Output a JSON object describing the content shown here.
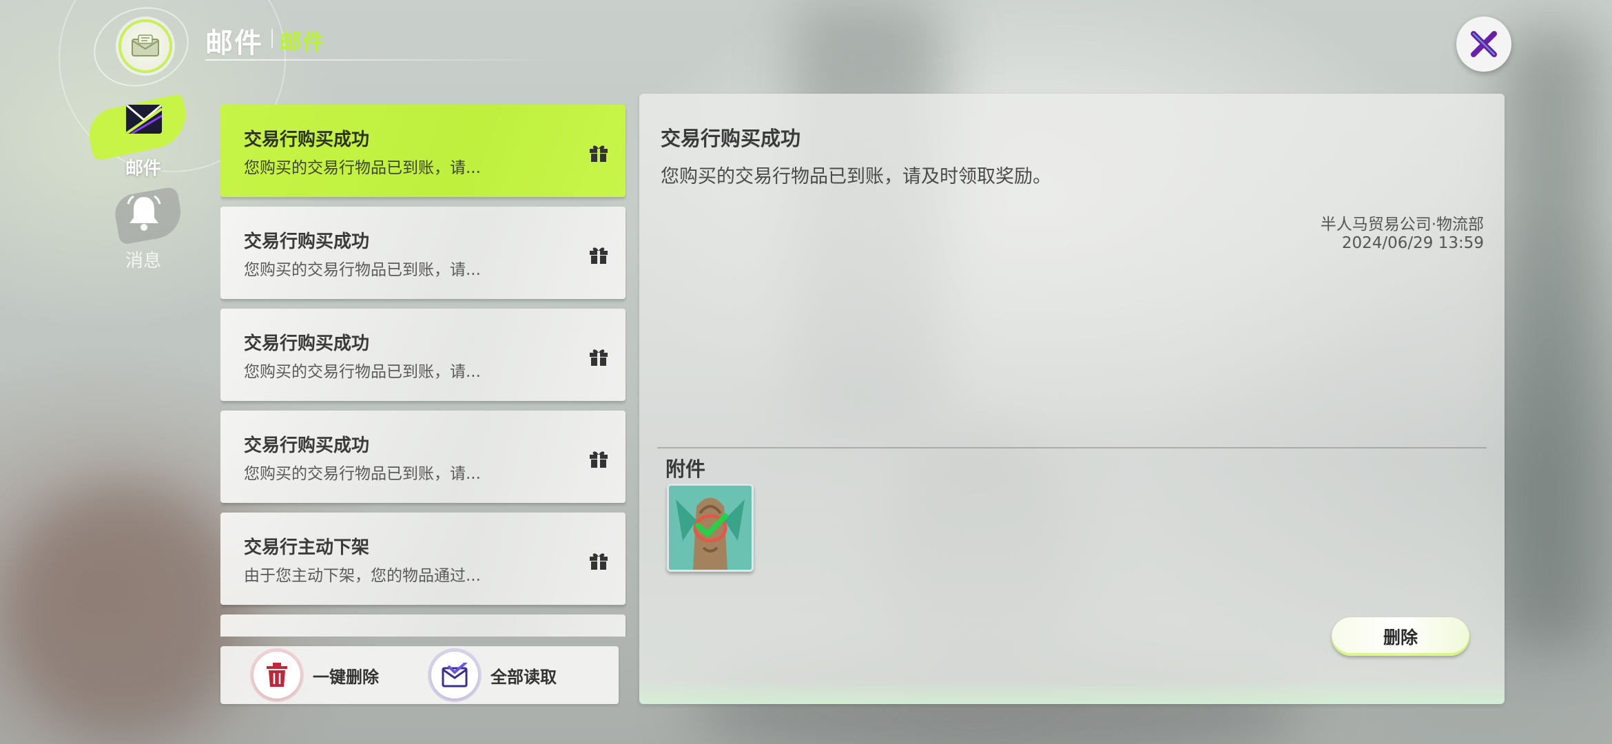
{
  "header": {
    "title": "邮件",
    "subtitle": "邮件",
    "icon": "mail-icon"
  },
  "nav": {
    "items": [
      {
        "label": "邮件",
        "icon": "mail-icon",
        "active": true
      },
      {
        "label": "消息",
        "icon": "bell-icon",
        "active": false
      }
    ]
  },
  "mail_list": {
    "items": [
      {
        "title": "交易行购买成功",
        "preview": "您购买的交易行物品已到账，请...",
        "icon": "gift-icon",
        "selected": true
      },
      {
        "title": "交易行购买成功",
        "preview": "您购买的交易行物品已到账，请...",
        "icon": "gift-icon",
        "selected": false
      },
      {
        "title": "交易行购买成功",
        "preview": "您购买的交易行物品已到账，请...",
        "icon": "gift-icon",
        "selected": false
      },
      {
        "title": "交易行购买成功",
        "preview": "您购买的交易行物品已到账，请...",
        "icon": "gift-icon",
        "selected": false
      },
      {
        "title": "交易行主动下架",
        "preview": "由于您主动下架，您的物品通过...",
        "icon": "gift-icon",
        "selected": false
      }
    ]
  },
  "list_footer": {
    "delete_all_label": "一键删除",
    "read_all_label": "全部读取"
  },
  "detail": {
    "title": "交易行购买成功",
    "body": "您购买的交易行物品已到账，请及时领取奖励。",
    "sender": "半人马贸易公司·物流部",
    "date": "2024/06/29  13:59",
    "attachments_label": "附件",
    "attachments": [
      {
        "icon": "creature-portrait-icon"
      }
    ],
    "delete_label": "删除"
  },
  "colors": {
    "accent": "#c7f447",
    "close_x": "#6b1fa8"
  }
}
